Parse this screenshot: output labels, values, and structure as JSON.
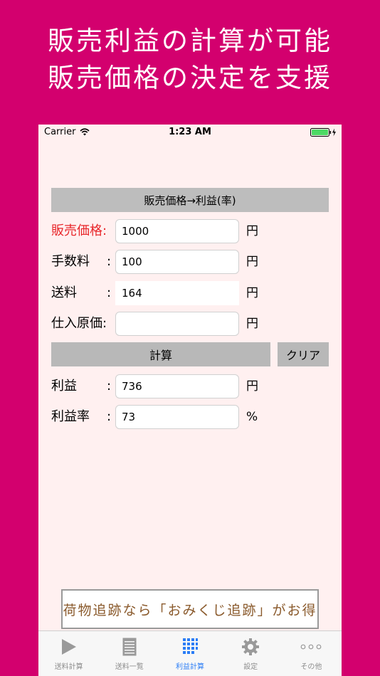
{
  "promo": {
    "line1": "販売利益の計算が可能",
    "line2": "販売価格の決定を支援"
  },
  "status_bar": {
    "carrier": "Carrier",
    "time": "1:23 AM",
    "battery_color": "#4cd964"
  },
  "section_title": "販売価格→利益(率)",
  "inputs": {
    "sale_price": {
      "label": "販売価格:",
      "sep": "",
      "value": "1000",
      "unit": "円"
    },
    "fee": {
      "label": "手数料",
      "sep": ":",
      "value": "100",
      "unit": "円"
    },
    "shipping": {
      "label": "送料",
      "sep": ":",
      "value": "164",
      "unit": "円"
    },
    "cost": {
      "label": "仕入原価:",
      "sep": "",
      "value": "",
      "unit": "円"
    }
  },
  "buttons": {
    "calculate": "計算",
    "clear": "クリア"
  },
  "results": {
    "profit": {
      "label": "利益",
      "sep": ":",
      "value": "736",
      "unit": "円"
    },
    "profit_rate": {
      "label": "利益率",
      "sep": ":",
      "value": "73",
      "unit": "%"
    }
  },
  "ad_banner": {
    "text": "荷物追跡なら「おみくじ追跡」がお得"
  },
  "tab_bar": {
    "items": [
      {
        "label": "送料計算",
        "icon": "play-icon"
      },
      {
        "label": "送料一覧",
        "icon": "list-icon"
      },
      {
        "label": "利益計算",
        "icon": "grid-icon",
        "active": true
      },
      {
        "label": "設定",
        "icon": "gear-icon"
      },
      {
        "label": "その他",
        "icon": "more-icon"
      }
    ],
    "active_color": "#2b7df6",
    "inactive_color": "#8e8e8e"
  },
  "colors": {
    "background": "#d3006e",
    "screen": "#fff0f0",
    "highlight_label": "#e8262a",
    "button": "#b8b8b8"
  }
}
